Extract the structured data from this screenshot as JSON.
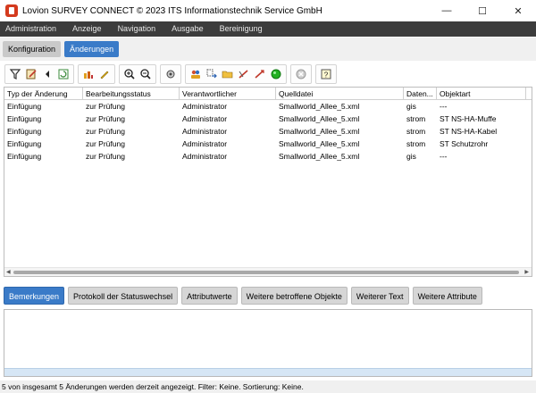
{
  "window": {
    "title": "Lovion SURVEY CONNECT © 2023 ITS Informationstechnik Service GmbH",
    "minimize": "—",
    "maximize": "☐",
    "close": "✕"
  },
  "menu": [
    "Administration",
    "Anzeige",
    "Navigation",
    "Ausgabe",
    "Bereinigung"
  ],
  "modes": [
    {
      "label": "Konfiguration",
      "active": false
    },
    {
      "label": "Änderungen",
      "active": true
    }
  ],
  "table": {
    "columns": [
      "Typ der Änderung",
      "Bearbeitungsstatus",
      "Verantwortlicher",
      "Quelldatei",
      "Daten...",
      "Objektart"
    ],
    "rows": [
      [
        "Einfügung",
        "zur Prüfung",
        "Administrator",
        "Smallworld_Allee_5.xml",
        "gis",
        "---"
      ],
      [
        "Einfügung",
        "zur Prüfung",
        "Administrator",
        "Smallworld_Allee_5.xml",
        "strom",
        "ST NS-HA-Muffe"
      ],
      [
        "Einfügung",
        "zur Prüfung",
        "Administrator",
        "Smallworld_Allee_5.xml",
        "strom",
        "ST NS-HA-Kabel"
      ],
      [
        "Einfügung",
        "zur Prüfung",
        "Administrator",
        "Smallworld_Allee_5.xml",
        "strom",
        "ST Schutzrohr"
      ],
      [
        "Einfügung",
        "zur Prüfung",
        "Administrator",
        "Smallworld_Allee_5.xml",
        "gis",
        "---"
      ]
    ]
  },
  "detail_tabs": [
    {
      "label": "Bemerkungen",
      "active": true
    },
    {
      "label": "Protokoll der Statuswechsel",
      "active": false
    },
    {
      "label": "Attributwerte",
      "active": false
    },
    {
      "label": "Weitere betroffene Objekte",
      "active": false
    },
    {
      "label": "Weiterer Text",
      "active": false
    },
    {
      "label": "Weitere Attribute",
      "active": false
    }
  ],
  "status": "5 von insgesamt 5 Änderungen werden derzeit angezeigt.   Filter: Keine.   Sortierung: Keine.",
  "colors": {
    "accent": "#3a7bc8",
    "menubar": "#3c3c3c",
    "brand": "#d43a1e"
  }
}
